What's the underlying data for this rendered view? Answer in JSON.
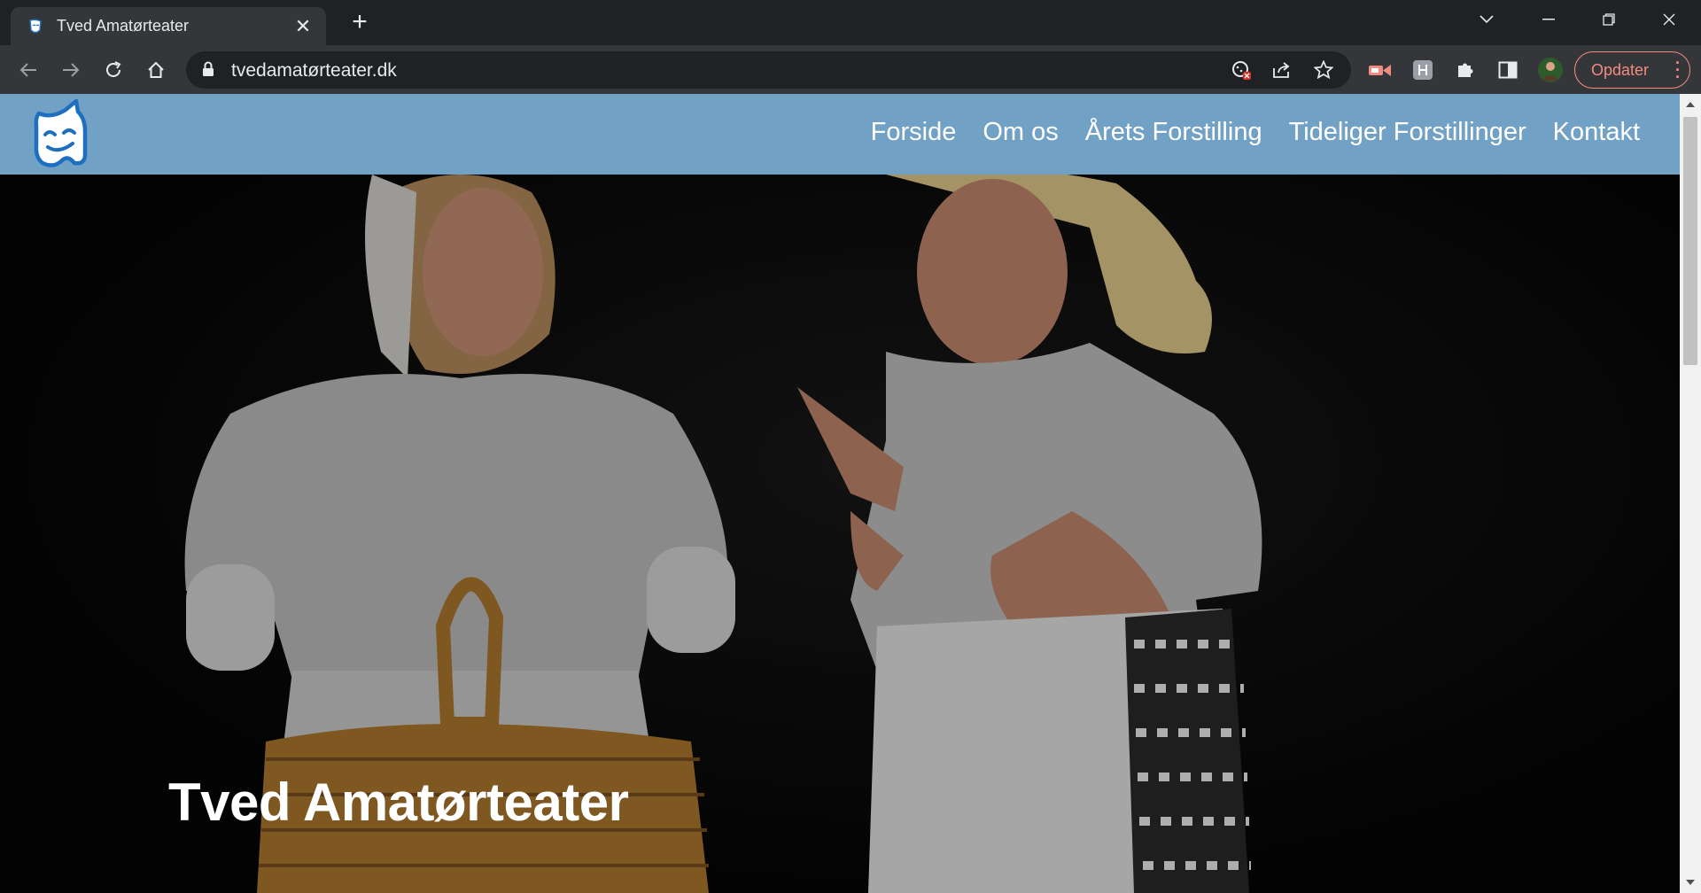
{
  "browser": {
    "tab": {
      "title": "Tved Amatørteater"
    },
    "url": "tvedamatørteater.dk",
    "update_label": "Opdater"
  },
  "site": {
    "nav": [
      {
        "label": "Forside"
      },
      {
        "label": "Om os"
      },
      {
        "label": "Årets Forstilling"
      },
      {
        "label": "Tideliger Forstillinger"
      },
      {
        "label": "Kontakt"
      }
    ],
    "hero_title": "Tved Amatørteater"
  },
  "colors": {
    "header_bg": "#71a1c4",
    "logo_blue": "#1f6fc0",
    "chrome_dark": "#202124",
    "chrome_toolbar": "#35363a",
    "update_accent": "#f28b82"
  },
  "icons": {
    "favicon": "theater-mask-icon",
    "logo": "theater-mask-logo"
  }
}
